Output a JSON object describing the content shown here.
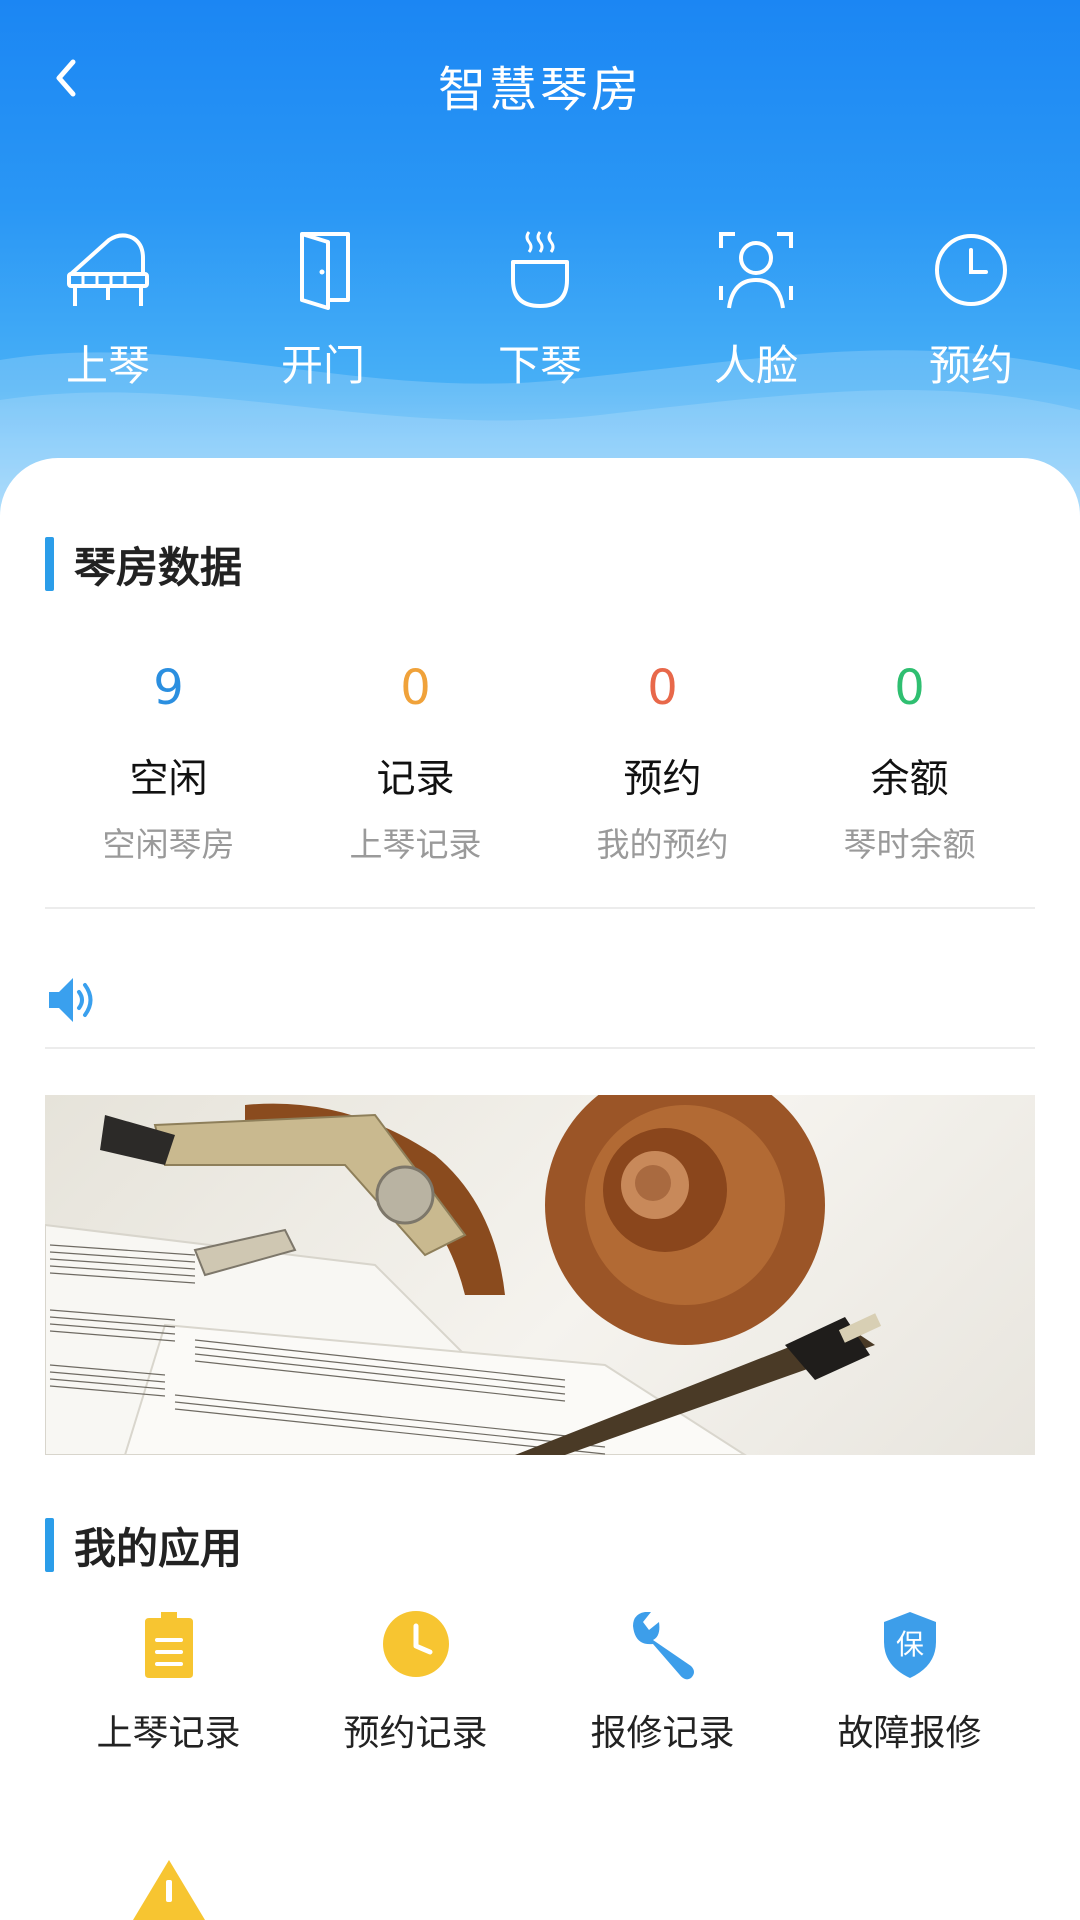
{
  "header": {
    "title": "智慧琴房",
    "back_icon": "back-arrow-icon",
    "actions": [
      {
        "label": "上琴",
        "icon": "piano-icon"
      },
      {
        "label": "开门",
        "icon": "door-icon"
      },
      {
        "label": "下琴",
        "icon": "cup-steam-icon"
      },
      {
        "label": "人脸",
        "icon": "face-scan-icon"
      },
      {
        "label": "预约",
        "icon": "clock-icon"
      }
    ]
  },
  "stats_section": {
    "title": "琴房数据",
    "items": [
      {
        "value": "9",
        "name": "空闲",
        "sub": "空闲琴房",
        "color": "#2b8fe0"
      },
      {
        "value": "0",
        "name": "记录",
        "sub": "上琴记录",
        "color": "#f0a23a"
      },
      {
        "value": "0",
        "name": "预约",
        "sub": "我的预约",
        "color": "#e8684a"
      },
      {
        "value": "0",
        "name": "余额",
        "sub": "琴时余额",
        "color": "#2fbf71"
      }
    ]
  },
  "notice": {
    "icon": "speaker-icon",
    "text": ""
  },
  "banner": {
    "image": "violin-scroll-sheet-music-photo"
  },
  "apps_section": {
    "title": "我的应用",
    "items": [
      {
        "label": "上琴记录",
        "icon": "clipboard-icon",
        "color": "#f7c531"
      },
      {
        "label": "预约记录",
        "icon": "clock-icon",
        "color": "#f7c531"
      },
      {
        "label": "报修记录",
        "icon": "wrench-icon",
        "color": "#3d9eea"
      },
      {
        "label": "故障报修",
        "icon": "shield-icon",
        "color": "#3d9eea",
        "badge": "保"
      },
      {
        "label": "",
        "icon": "warning-icon",
        "color": "#f7c531"
      }
    ]
  },
  "colors": {
    "primary": "#1b86f3",
    "accent_bar": "#2b9de9"
  }
}
